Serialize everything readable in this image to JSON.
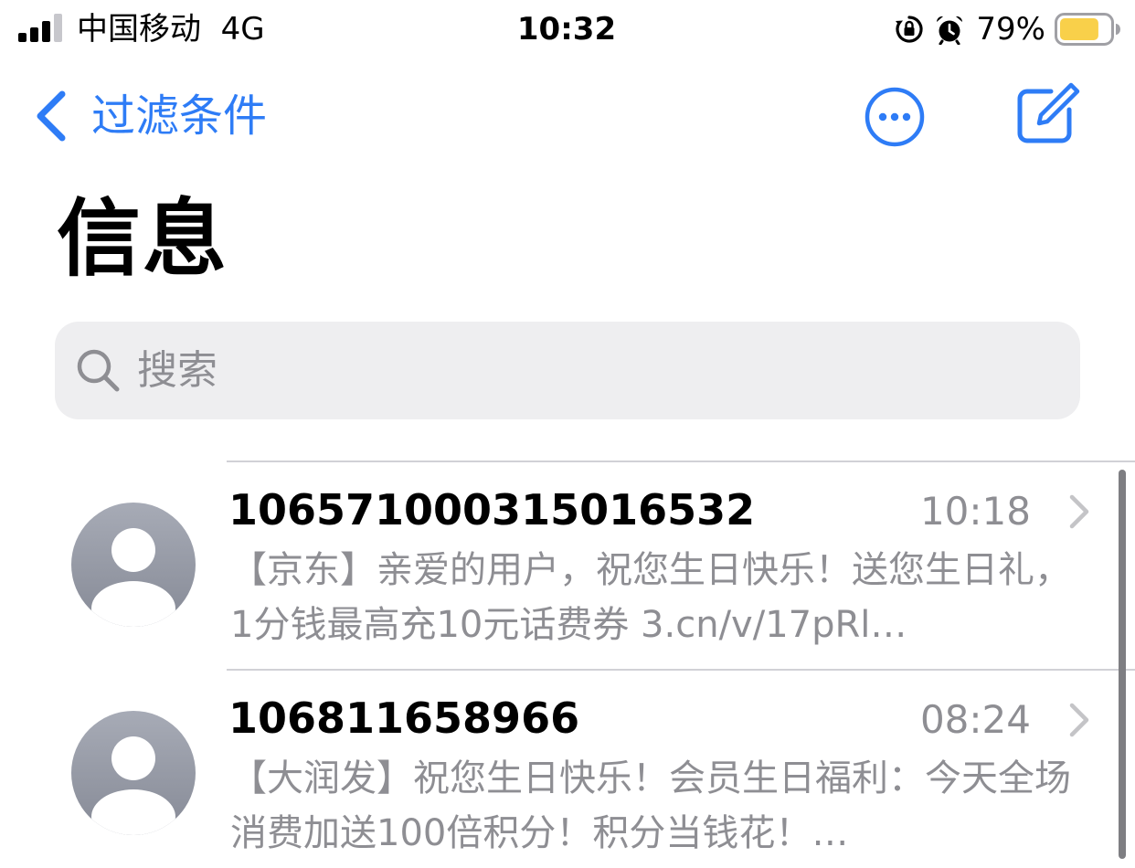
{
  "status_bar": {
    "carrier": "中国移动",
    "network": "4G",
    "time": "10:32",
    "battery_percent": "79%",
    "battery_level": 0.79,
    "battery_color": "#F9D04A",
    "icons": [
      "signal-icon",
      "orientation-lock-icon",
      "alarm-icon",
      "battery-icon"
    ]
  },
  "nav": {
    "back_label": "过滤条件",
    "accent_color": "#2E7CF6",
    "icons": [
      "chevron-left-icon",
      "more-icon",
      "compose-icon"
    ]
  },
  "title": "信息",
  "search": {
    "placeholder": "搜索",
    "value": ""
  },
  "messages": [
    {
      "sender": "106571000315016532",
      "time": "10:18",
      "preview": "【京东】亲爱的用户，祝您生日快乐！送您生日礼，1分钱最高充10元话费券 3.cn/v/17pRl…"
    },
    {
      "sender": "106811658966",
      "time": "08:24",
      "preview": "【大润发】祝您生日快乐！会员生日福利：今天全场消费加送100倍积分！积分当钱花！…"
    }
  ]
}
